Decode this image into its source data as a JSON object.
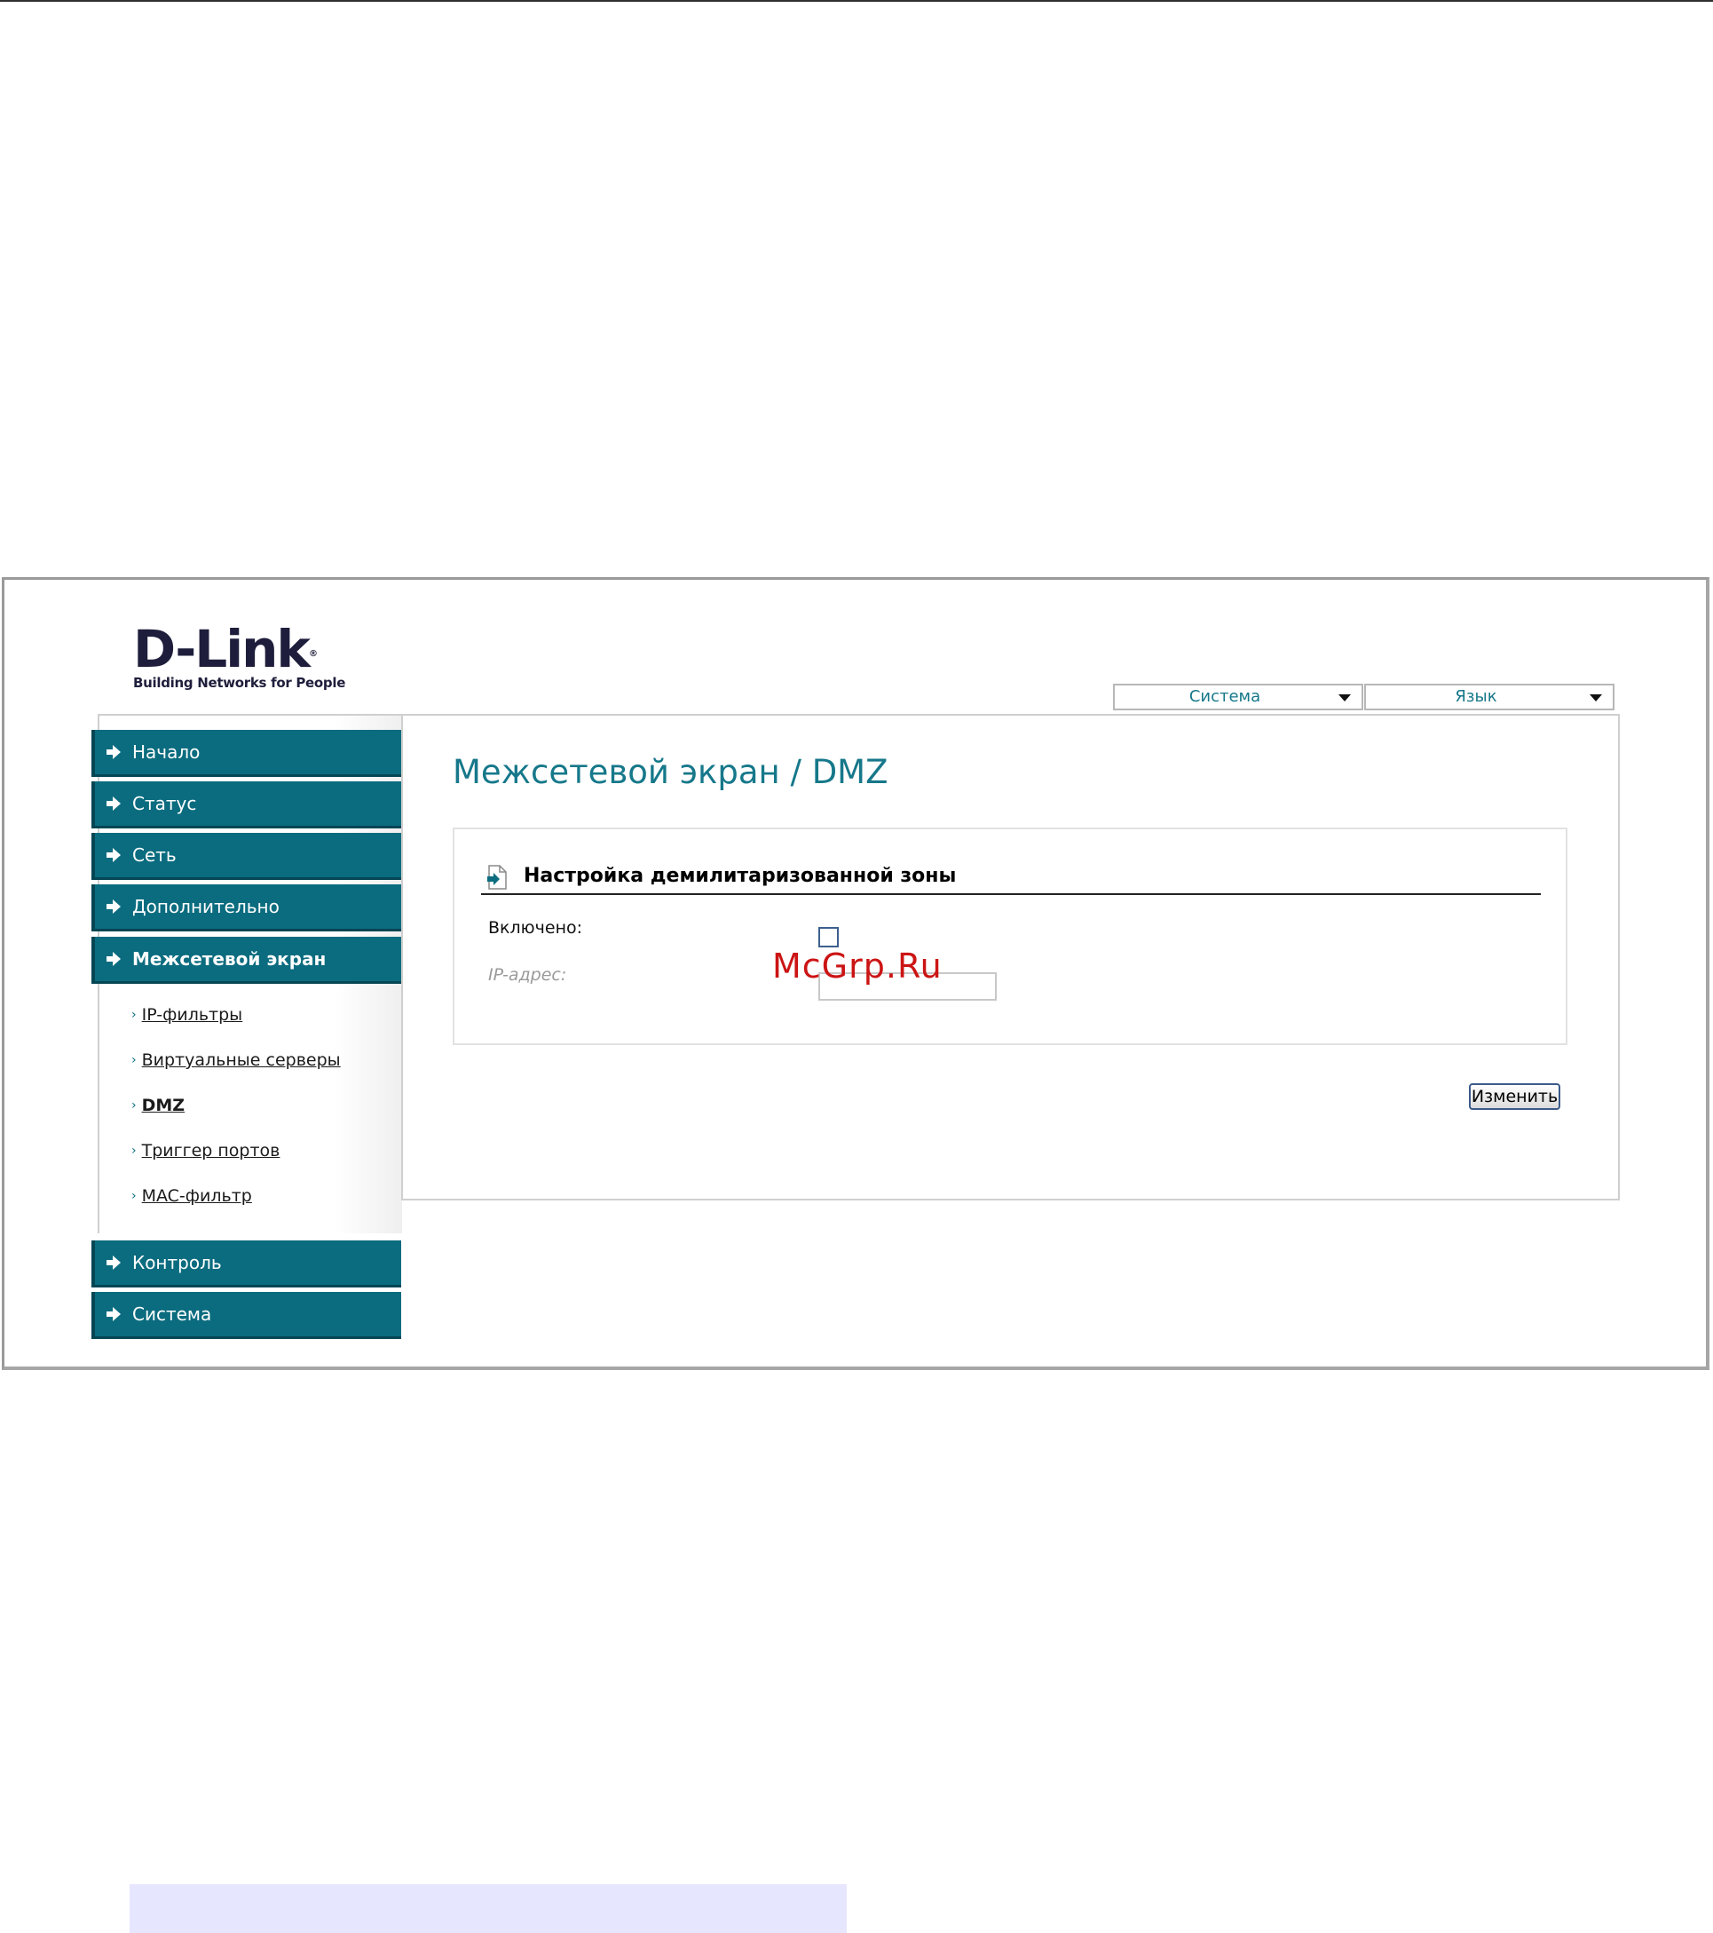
{
  "logo": {
    "brand": "D-Link",
    "registered": "®",
    "tagline": "Building Networks for People"
  },
  "top_menus": {
    "system": "Система",
    "language": "Язык"
  },
  "sidebar": {
    "items": [
      {
        "label": "Начало"
      },
      {
        "label": "Статус"
      },
      {
        "label": "Сеть"
      },
      {
        "label": "Дополнительно"
      },
      {
        "label": "Межсетевой экран"
      },
      {
        "label": "Контроль"
      },
      {
        "label": "Система"
      }
    ],
    "subitems": [
      {
        "label": "IP-фильтры"
      },
      {
        "label": "Виртуальные серверы"
      },
      {
        "label": "DMZ"
      },
      {
        "label": "Триггер портов"
      },
      {
        "label": "MAC-фильтр"
      }
    ]
  },
  "page": {
    "title": "Межсетевой экран /  DMZ",
    "section_title": "Настройка демилитаризованной зоны",
    "enabled_label": "Включено:",
    "enabled_checked": false,
    "ip_label": "IP-адрес:",
    "ip_value": "",
    "change_button": "Изменить"
  },
  "watermark": "McGrp.Ru",
  "colors": {
    "teal": "#0b6c7f",
    "title": "#16788a",
    "watermark": "#cc1414"
  }
}
